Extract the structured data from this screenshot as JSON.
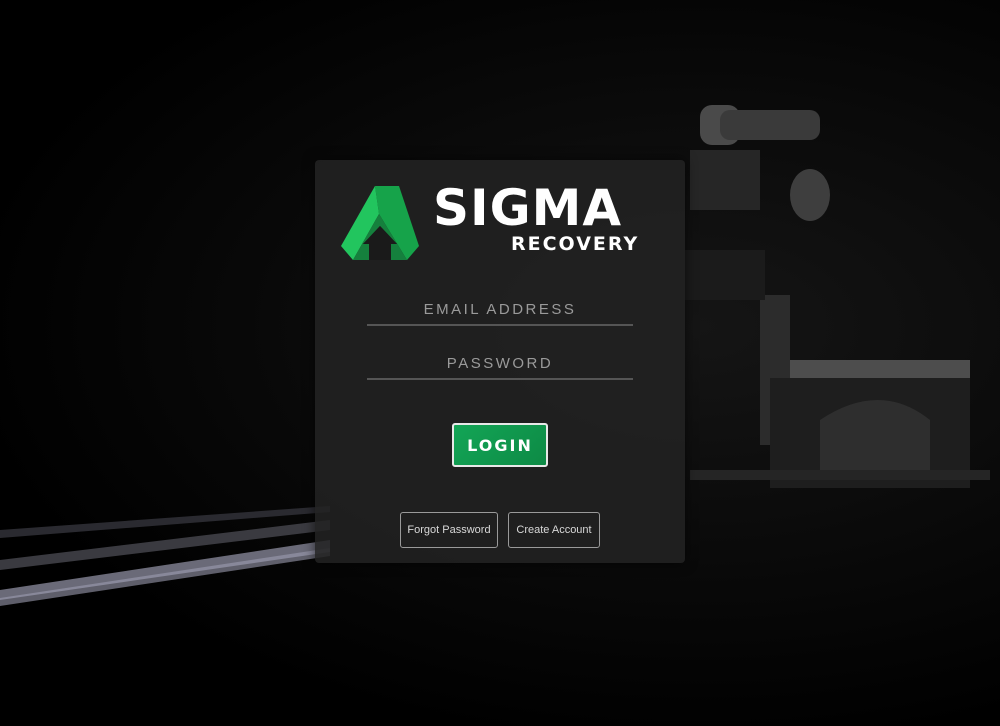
{
  "brand": {
    "name": "SIGMA",
    "tagline": "RECOVERY",
    "accent_color": "#13a556",
    "logo_icon": "up-arrow-triangle-icon"
  },
  "form": {
    "email": {
      "placeholder": "EMAIL ADDRESS",
      "value": ""
    },
    "password": {
      "placeholder": "PASSWORD",
      "value": ""
    },
    "login_label": "LOGIN"
  },
  "links": {
    "forgot_password_label": "Forgot Password",
    "create_account_label": "Create Account"
  }
}
